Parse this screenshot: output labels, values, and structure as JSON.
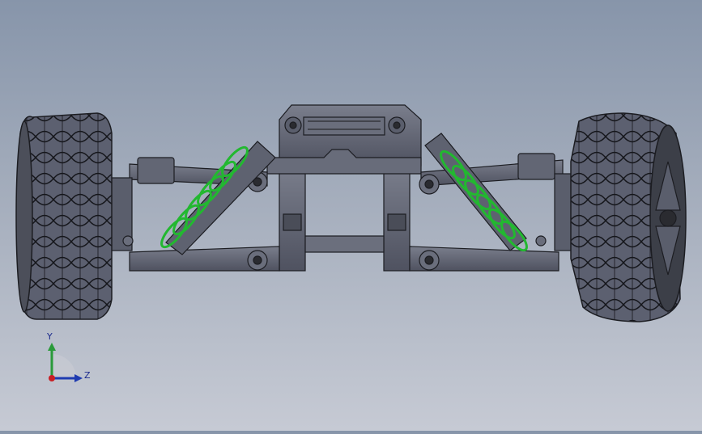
{
  "viewport": {
    "background_top": "#8795aa",
    "background_bottom": "#c6cad4"
  },
  "model": {
    "part_color": "#5e6270",
    "edge_color": "#1c1d22",
    "spring_color": "#22b830",
    "tire_color": "#5a5e6c"
  },
  "triad": {
    "y_label": "Y",
    "z_label": "Z",
    "y_color": "#2a9a3a",
    "z_color": "#1f3bb0",
    "x_color": "#c81f25"
  }
}
